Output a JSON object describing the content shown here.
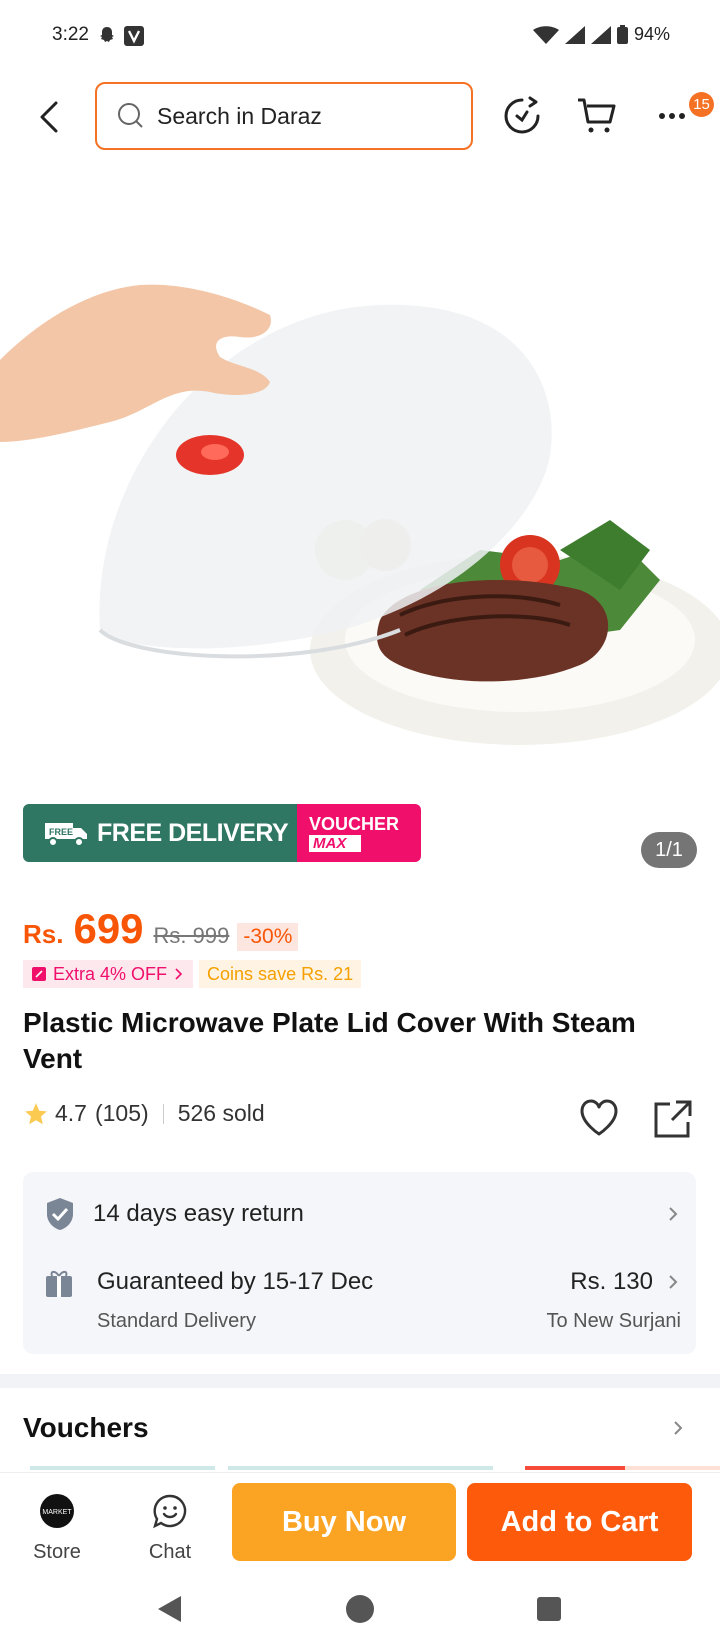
{
  "status_bar": {
    "time": "3:22",
    "battery": "94%"
  },
  "header": {
    "search_placeholder": "Search in Daraz",
    "notification_count": "15"
  },
  "gallery": {
    "counter": "1/1"
  },
  "promo_banner": {
    "free_delivery": "FREE DELIVERY",
    "free_tag": "FREE",
    "voucher_line1": "VOUCHER",
    "voucher_line2": "MAX"
  },
  "price": {
    "currency": "Rs.",
    "current": "699",
    "original": "Rs. 999",
    "discount": "-30%"
  },
  "tags": {
    "extra_off": "Extra 4% OFF",
    "coins": "Coins save Rs. 21"
  },
  "product": {
    "title": "Plastic Microwave Plate Lid Cover With Steam Vent",
    "rating": "4.7",
    "reviews": "(105)",
    "sold": "526 sold"
  },
  "service": {
    "return_text": "14 days easy return",
    "delivery_text": "Guaranteed by 15-17 Dec",
    "delivery_type": "Standard Delivery",
    "delivery_fee": "Rs. 130",
    "destination": "To New Surjani"
  },
  "vouchers": {
    "title": "Vouchers"
  },
  "bottom_bar": {
    "store": "Store",
    "store_logo_text": "MARKET",
    "chat": "Chat",
    "buy_now": "Buy Now",
    "add_to_cart": "Add to Cart"
  },
  "colors": {
    "accent": "#f85606",
    "buy_now": "#fba424",
    "add_to_cart": "#fd5a0c",
    "free_delivery": "#2f7762",
    "voucher": "#f0106c"
  }
}
